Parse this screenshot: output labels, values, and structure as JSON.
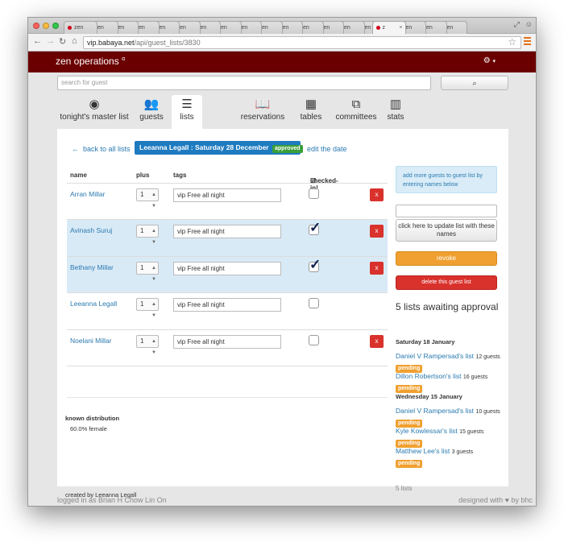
{
  "browser": {
    "tabs": [
      "zen",
      "zen",
      "zen",
      "zen",
      "zen",
      "zen",
      "zen",
      "zen",
      "zen",
      "zen",
      "zen",
      "zen",
      "zen",
      "zen",
      "zen",
      "zen",
      "zen",
      "zen",
      "zen"
    ],
    "active_tab_label": "z",
    "url_host": "vip.babaya.net",
    "url_path": "/api/guest_lists/3830"
  },
  "app": {
    "brand": "zen operations",
    "brand_mark": "α",
    "settings_icon": "gear-icon",
    "search_placeholder": "search for guest",
    "search_button_icon": "search-icon"
  },
  "nav_tabs": [
    {
      "label": "tonight's master list",
      "icon": "globe-icon"
    },
    {
      "label": "guests",
      "icon": "users-icon"
    },
    {
      "label": "lists",
      "icon": "list-icon",
      "active": true
    },
    {
      "label": "reservations",
      "icon": "book-icon"
    },
    {
      "label": "tables",
      "icon": "grid-icon"
    },
    {
      "label": "committees",
      "icon": "sitemap-icon"
    },
    {
      "label": "stats",
      "icon": "bar-chart-icon"
    }
  ],
  "main": {
    "back_link": "back to all lists",
    "list_title": "Leeanna Legall : Saturday 28 December",
    "status_badge": "approved",
    "edit_date": "edit the date",
    "columns": [
      "name",
      "plus",
      "tags",
      "checked-in!"
    ],
    "guests": [
      {
        "name": "Arran Millar",
        "plus": "1",
        "tag": "vip Free all night",
        "checked": false,
        "highlight": false,
        "deletable": true
      },
      {
        "name": "Avinash Suruj",
        "plus": "1",
        "tag": "vip Free all night",
        "checked": true,
        "highlight": true,
        "deletable": true
      },
      {
        "name": "Bethany Millar",
        "plus": "1",
        "tag": "vip Free all night",
        "checked": true,
        "highlight": true,
        "deletable": true
      },
      {
        "name": "Leeanna Legall",
        "plus": "1",
        "tag": "vip Free all night",
        "checked": false,
        "highlight": false,
        "deletable": false
      },
      {
        "name": "Noelani Millar",
        "plus": "1",
        "tag": "vip Free all night",
        "checked": false,
        "highlight": false,
        "deletable": true
      }
    ],
    "delete_label": "x",
    "distribution_title": "known distribution",
    "distribution_value": "60.0% female",
    "created_by": "created by Leeanna Legall"
  },
  "sidebar": {
    "info": "add more guests to guest list by entering names below",
    "update_button": "click here to update list with these names",
    "revoke_button": "revoke",
    "delete_button": "delete this guest list",
    "awaiting_title": "5 lists awaiting approval",
    "groups": [
      {
        "date": "Saturday 18 January",
        "lists": [
          {
            "name": "Daniel V Rampersad's list",
            "count": "12 guests",
            "status": "pending"
          },
          {
            "name": "Dillon Robertson's list",
            "count": "16 guests",
            "status": "pending"
          }
        ]
      },
      {
        "date": "Wednesday 15 January",
        "lists": [
          {
            "name": "Daniel V Rampersad's list",
            "count": "10 guests",
            "status": "pending"
          },
          {
            "name": "Kyle Kowlessar's list",
            "count": "15 guests",
            "status": "pending"
          },
          {
            "name": "Matthew Lee's list",
            "count": "3 guests",
            "status": "pending"
          }
        ]
      }
    ],
    "total": "5 lists"
  },
  "footer": {
    "logged_in": "logged in as Brian H Chow Lin On",
    "designed": "designed with ♥ by bhc"
  }
}
